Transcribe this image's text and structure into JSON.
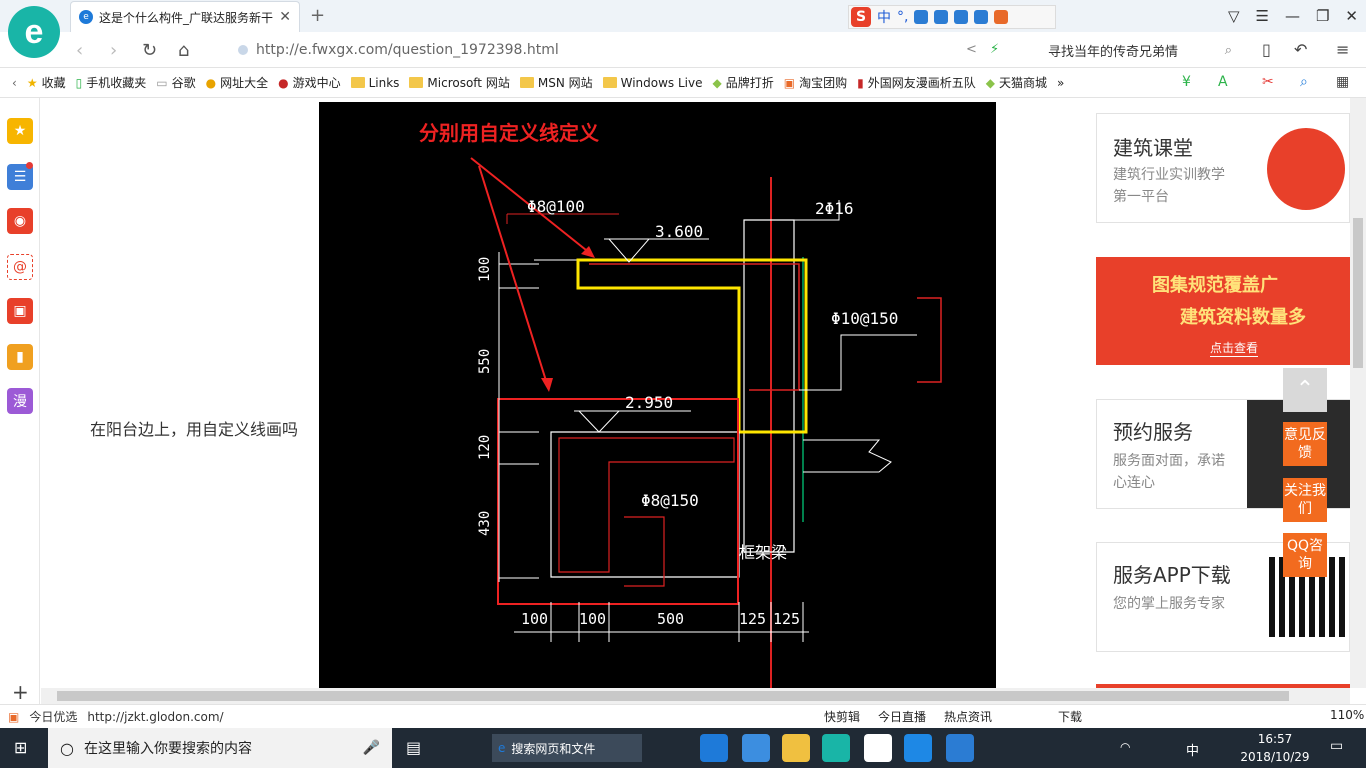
{
  "browser": {
    "tab_title": "这是个什么构件_广联达服务新干",
    "url": "http://e.fwxgx.com/question_1972398.html",
    "search_text": "寻找当年的传奇兄弟情",
    "sogou_label": "中"
  },
  "bookmarks": [
    "收藏",
    "手机收藏夹",
    "谷歌",
    "网址大全",
    "游戏中心",
    "Links",
    "Microsoft 网站",
    "MSN 网站",
    "Windows Live",
    "品牌打折",
    "淘宝团购",
    "外国网友漫画析五队",
    "天猫商城"
  ],
  "sidebar": {
    "manga_label": "漫"
  },
  "question_text": "在阳台边上，用自定义线画吗",
  "cad": {
    "annotation": "分别用自定义线定义",
    "rebar_top": "Φ8@100",
    "elev_top": "3.600",
    "col_rebar": "2Φ16",
    "stirrup": "Φ10@150",
    "elev_low": "2.950",
    "rebar_low": "Φ8@150",
    "beam_label": "框架梁",
    "dim_100": "100",
    "dim_550": "550",
    "dim_120": "120",
    "dim_430": "430",
    "bdim_1": "100",
    "bdim_2": "100",
    "bdim_3": "500",
    "bdim_4": "125",
    "bdim_5": "125"
  },
  "ads": [
    {
      "title": "建筑课堂",
      "desc": "建筑行业实训教学第一平台"
    },
    {
      "title": "图集规范覆盖广",
      "sub": "建筑资料数量多",
      "cta": "点击查看"
    },
    {
      "title": "预约服务",
      "desc": "服务面对面，承诺心连心"
    },
    {
      "title": "服务APP下载",
      "desc": "您的掌上服务专家"
    }
  ],
  "floats": [
    "意见反馈",
    "关注我们",
    "QQ咨询"
  ],
  "status": {
    "left_label": "今日优选",
    "hover_url": "http://jzkt.glodon.com/",
    "items": [
      "快剪辑",
      "今日直播",
      "热点资讯",
      "下载"
    ],
    "zoom": "110%"
  },
  "taskbar": {
    "search_placeholder": "在这里输入你要搜索的内容",
    "web_search": "搜索网页和文件",
    "ime": "中",
    "time": "16:57",
    "date": "2018/10/29"
  }
}
